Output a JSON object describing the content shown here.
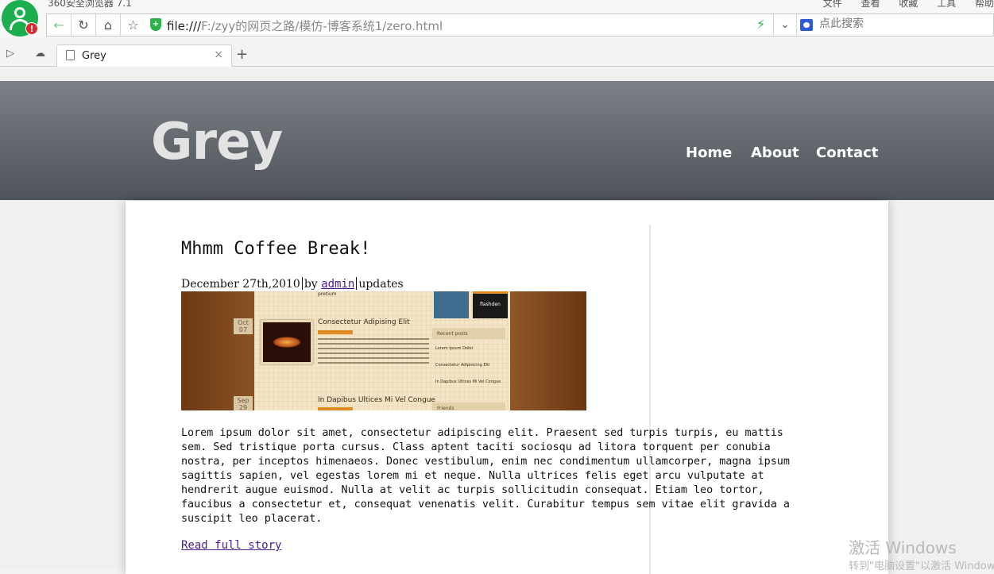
{
  "browser": {
    "title": "360安全浏览器 7.1",
    "menu": [
      "文件",
      "查看",
      "收藏",
      "工具",
      "帮助"
    ],
    "url_prefix": "file:///",
    "url_path": "F:/zyy的网页之路/模仿-博客系统1/zero.html",
    "search_placeholder": "点此搜索",
    "tab_title": "Grey",
    "tab_close": "×",
    "new_tab": "+"
  },
  "site": {
    "logo": "Grey",
    "nav": [
      "Home",
      "About",
      "Contact"
    ]
  },
  "post": {
    "title": "Mhmm Coffee Break!",
    "date": "December 27th,2010",
    "by": "by",
    "author": "admin",
    "category": "updates",
    "image": {
      "top_text": "pretium",
      "date1_month": "Oct",
      "date1_day": "07",
      "date2_month": "Sep",
      "date2_day": "29",
      "heading1": "Consectetur Adipising Elit",
      "heading2": "In Dapibus Ultices Mi Vel Congue",
      "recent_posts": "Recent posts",
      "recent_items": [
        "Lorem Ipsum Dolor",
        "Consectetur Adipisicing Elit",
        "In Dapibus Ultices Mi Vel Congue"
      ],
      "friends": "Friends",
      "flash_label": "flashden"
    },
    "body": "Lorem ipsum dolor sit amet, consectetur adipiscing elit. Praesent sed turpis turpis, eu mattis sem. Sed tristique porta cursus. Class aptent taciti sociosqu ad litora torquent per conubia nostra, per inceptos himenaeos. Donec vestibulum, enim nec condimentum ullamcorper, magna ipsum sagittis sapien, vel egestas lorem mi et neque. Nulla ultrices felis eget arcu vulputate at hendrerit augue euismod. Nulla at velit ac turpis sollicitudin consequat. Etiam leo tortor, faucibus a consectetur et, consequat venenatis velit. Curabitur tempus sem vitae elit gravida a suscipit leo placerat.",
    "read_more": "Read full story"
  },
  "os_watermark": {
    "title": "激活 Windows",
    "subtitle": "转到\"电脑设置\"以激活 Windows"
  },
  "colors": {
    "header_top": "#7b7f86",
    "header_bottom": "#4f545b",
    "link_visited": "#4a1a8a",
    "browser_green": "#1aae4e"
  }
}
